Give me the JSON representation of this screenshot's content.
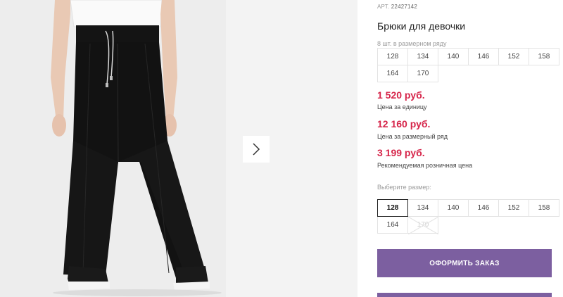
{
  "product": {
    "article_prefix": "АРТ.",
    "article_number": "22427142",
    "title": "Брюки для девочки",
    "size_row_note": "8 шт. в размерном ряду",
    "size_row": [
      "128",
      "134",
      "140",
      "146",
      "152",
      "158",
      "164",
      "170"
    ]
  },
  "prices": [
    {
      "value": "1 520 руб.",
      "label": "Цена за единицу"
    },
    {
      "value": "12 160 руб.",
      "label": "Цена за размерный ряд"
    },
    {
      "value": "3 199 руб.",
      "label": "Рекомендуемая розничная цена"
    }
  ],
  "size_selector": {
    "label": "Выберите размер:",
    "sizes": [
      "128",
      "134",
      "140",
      "146",
      "152",
      "158",
      "164",
      "170"
    ],
    "selected": "128",
    "unavailable": [
      "170"
    ]
  },
  "buttons": {
    "order": "ОФОРМИТЬ ЗАКАЗ"
  },
  "gallery": {
    "next_icon": "chevron-right-icon",
    "image_subject": "girl in black wide-leg trousers"
  },
  "colors": {
    "price": "#d6254a",
    "accent_button": "#7c5fa0"
  }
}
